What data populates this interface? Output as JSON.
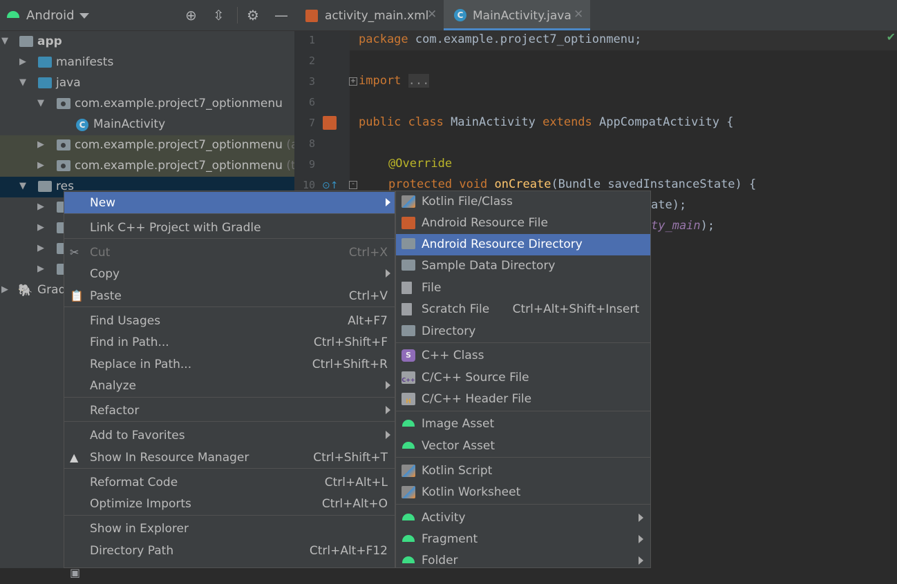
{
  "project_panel": {
    "view_label": "Android",
    "tree": [
      {
        "label": "app"
      },
      {
        "label": "manifests"
      },
      {
        "label": "java"
      },
      {
        "label": "com.example.project7_optionmenu"
      },
      {
        "label": "MainActivity"
      },
      {
        "label": "com.example.project7_optionmenu",
        "suffix": "(an"
      },
      {
        "label": "com.example.project7_optionmenu",
        "suffix": "(tes"
      },
      {
        "label": "res"
      },
      {
        "label": "Grad"
      }
    ]
  },
  "editor": {
    "tabs": [
      {
        "label": "activity_main.xml"
      },
      {
        "label": "MainActivity.java"
      }
    ],
    "line_numbers": [
      "1",
      "2",
      "3",
      "6",
      "7",
      "8",
      "9",
      "10"
    ],
    "code": {
      "l1_kw": "package",
      "l1_rest": " com.example.project7_optionmenu;",
      "l3_kw": "import",
      "l3_fold": "...",
      "l7_kw1": "public class",
      "l7_name": " MainActivity ",
      "l7_kw2": "extends",
      "l7_rest": " AppCompatActivity {",
      "l9_ann": "@Override",
      "l10_kw": "protected void",
      "l10_fn": "onCreate",
      "l10_rest": "(Bundle savedInstanceState) {",
      "l11_rest": "ate);",
      "l12_it": "ty_main",
      "l12_rest": ");"
    }
  },
  "context_menu": {
    "items": [
      {
        "label": "New",
        "shortcut": ""
      },
      {
        "label": "Link C++ Project with Gradle",
        "shortcut": ""
      },
      {
        "label": "Cut",
        "shortcut": "Ctrl+X"
      },
      {
        "label": "Copy",
        "shortcut": ""
      },
      {
        "label": "Paste",
        "shortcut": "Ctrl+V"
      },
      {
        "label": "Find Usages",
        "shortcut": "Alt+F7"
      },
      {
        "label": "Find in Path...",
        "shortcut": "Ctrl+Shift+F"
      },
      {
        "label": "Replace in Path...",
        "shortcut": "Ctrl+Shift+R"
      },
      {
        "label": "Analyze",
        "shortcut": ""
      },
      {
        "label": "Refactor",
        "shortcut": ""
      },
      {
        "label": "Add to Favorites",
        "shortcut": ""
      },
      {
        "label": "Show In Resource Manager",
        "shortcut": "Ctrl+Shift+T"
      },
      {
        "label": "Reformat Code",
        "shortcut": "Ctrl+Alt+L"
      },
      {
        "label": "Optimize Imports",
        "shortcut": "Ctrl+Alt+O"
      },
      {
        "label": "Show in Explorer",
        "shortcut": ""
      },
      {
        "label": "Directory Path",
        "shortcut": "Ctrl+Alt+F12"
      }
    ]
  },
  "new_submenu": {
    "items": [
      {
        "label": "Kotlin File/Class",
        "shortcut": ""
      },
      {
        "label": "Android Resource File",
        "shortcut": ""
      },
      {
        "label": "Android Resource Directory",
        "shortcut": ""
      },
      {
        "label": "Sample Data Directory",
        "shortcut": ""
      },
      {
        "label": "File",
        "shortcut": ""
      },
      {
        "label": "Scratch File",
        "shortcut": "Ctrl+Alt+Shift+Insert"
      },
      {
        "label": "Directory",
        "shortcut": ""
      },
      {
        "label": "C++ Class",
        "shortcut": ""
      },
      {
        "label": "C/C++ Source File",
        "shortcut": ""
      },
      {
        "label": "C/C++ Header File",
        "shortcut": ""
      },
      {
        "label": "Image Asset",
        "shortcut": ""
      },
      {
        "label": "Vector Asset",
        "shortcut": ""
      },
      {
        "label": "Kotlin Script",
        "shortcut": ""
      },
      {
        "label": "Kotlin Worksheet",
        "shortcut": ""
      },
      {
        "label": "Activity",
        "shortcut": ""
      },
      {
        "label": "Fragment",
        "shortcut": ""
      },
      {
        "label": "Folder",
        "shortcut": ""
      }
    ]
  },
  "icons": {
    "c_class_letter": "C",
    "cpp_class_letter": "S",
    "cpp_source_letter": "C++",
    "header_letter": "H"
  },
  "colors": {
    "selection": "#4b6eaf",
    "accent_tab": "#4a88c7",
    "android_green": "#3ddc84"
  }
}
